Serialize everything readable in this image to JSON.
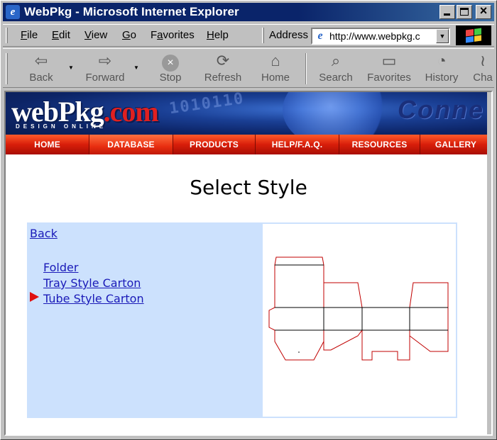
{
  "window": {
    "title": "WebPkg - Microsoft Internet Explorer"
  },
  "menu": {
    "items": [
      {
        "key": "F",
        "rest": "ile"
      },
      {
        "key": "E",
        "rest": "dit"
      },
      {
        "key": "V",
        "rest": "iew"
      },
      {
        "key": "G",
        "rest": "o"
      },
      {
        "key": "a",
        "pre": "F",
        "rest": "vorites"
      },
      {
        "key": "H",
        "rest": "elp"
      }
    ],
    "address_label": "Address",
    "address_value": "http://www.webpkg.c"
  },
  "toolbar": {
    "back": "Back",
    "forward": "Forward",
    "stop": "Stop",
    "refresh": "Refresh",
    "home": "Home",
    "search": "Search",
    "favorites": "Favorites",
    "history": "History",
    "channels": "Cha"
  },
  "site": {
    "logo_main": "webPkg",
    "logo_dot": ".com",
    "tagline": "DESIGN ONLINE",
    "banner_word": "Conne",
    "banner_digits": "1010110",
    "nav": [
      "HOME",
      "DATABASE",
      "PRODUCTS",
      "HELP/F.A.Q.",
      "RESOURCES",
      "GALLERY"
    ],
    "active_nav": "DATABASE"
  },
  "page": {
    "title": "Select Style",
    "back_link": "Back",
    "styles": [
      "Folder",
      "Tray Style Carton",
      "Tube Style Carton"
    ],
    "selected_style": "Tube Style Carton",
    "colors": {
      "panel_bg": "#cce1fd",
      "link": "#1a1ab8",
      "selection_arrow": "#e01010",
      "dieline_cut": "#c00000",
      "dieline_fold": "#000000",
      "nav_red": "#d81e0a"
    }
  }
}
